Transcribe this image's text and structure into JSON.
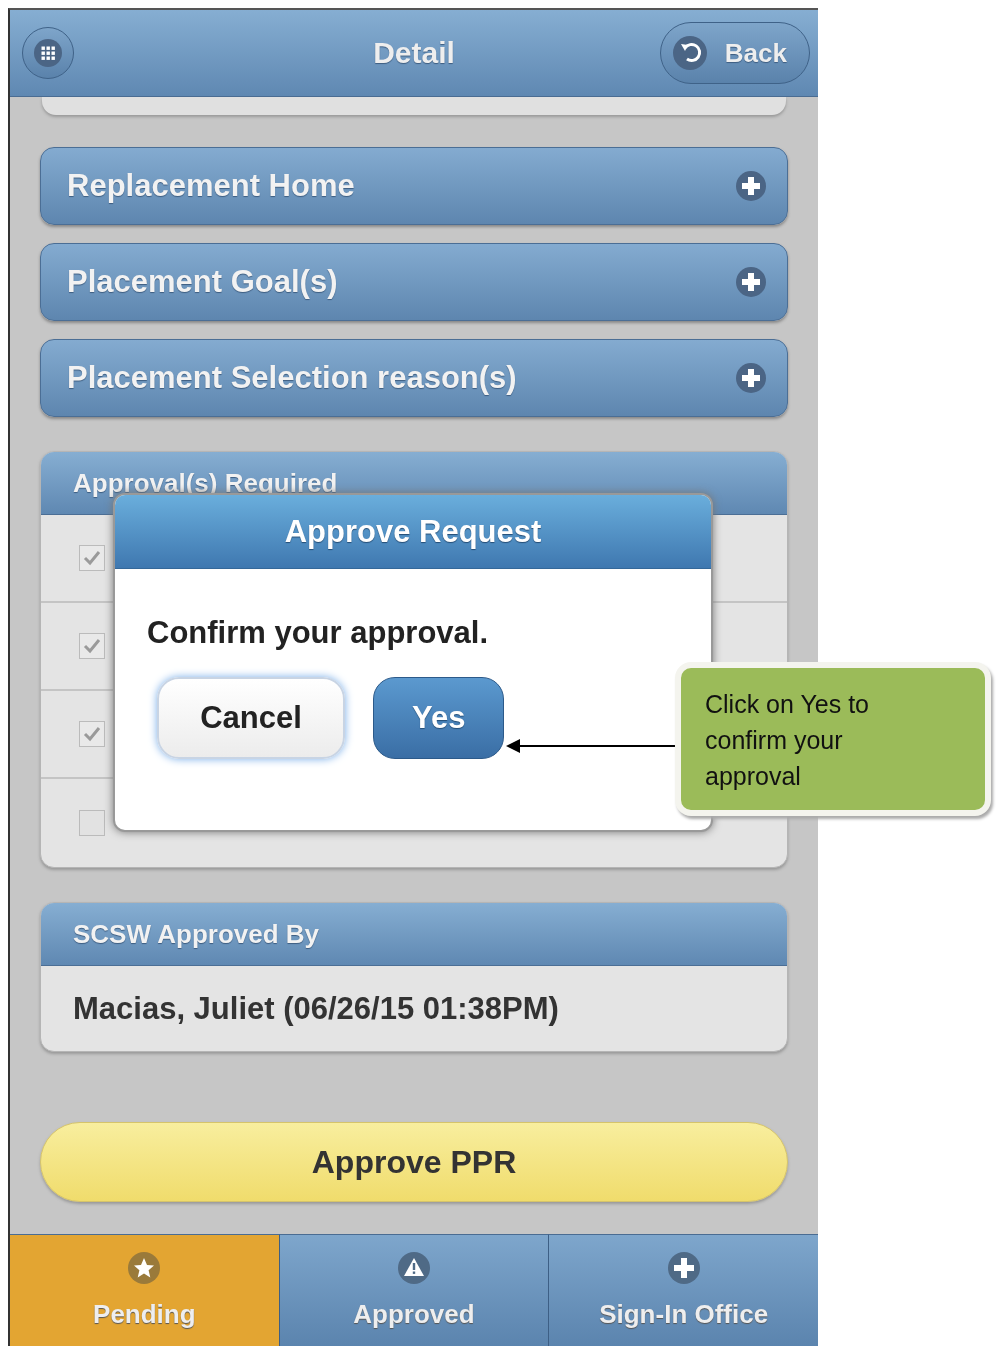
{
  "header": {
    "title": "Detail",
    "back_label": "Back"
  },
  "accordions": [
    {
      "title": "Replacement Home",
      "expanded": false
    },
    {
      "title": "Placement Goal(s)",
      "expanded": false
    },
    {
      "title": "Placement Selection reason(s)",
      "expanded": false
    }
  ],
  "approvals": {
    "title": "Approval(s) Required",
    "items": [
      {
        "checked": true
      },
      {
        "checked": true
      },
      {
        "checked": true
      },
      {
        "checked": false
      }
    ]
  },
  "scsw": {
    "title": "SCSW Approved By",
    "value": "Macias, Juliet (06/26/15 01:38PM)"
  },
  "approve_button": "Approve PPR",
  "nav": [
    {
      "label": "Pending",
      "kind": "star",
      "selected": true
    },
    {
      "label": "Approved",
      "kind": "alert",
      "selected": false
    },
    {
      "label": "Sign-In Office",
      "kind": "plus",
      "selected": false
    }
  ],
  "dialog": {
    "title": "Approve Request",
    "message": "Confirm your approval.",
    "buttons": [
      {
        "label": "Cancel",
        "kind": "secondary"
      },
      {
        "label": "Yes",
        "kind": "primary"
      }
    ]
  },
  "callout": {
    "text": "Click on Yes to confirm your approval"
  }
}
